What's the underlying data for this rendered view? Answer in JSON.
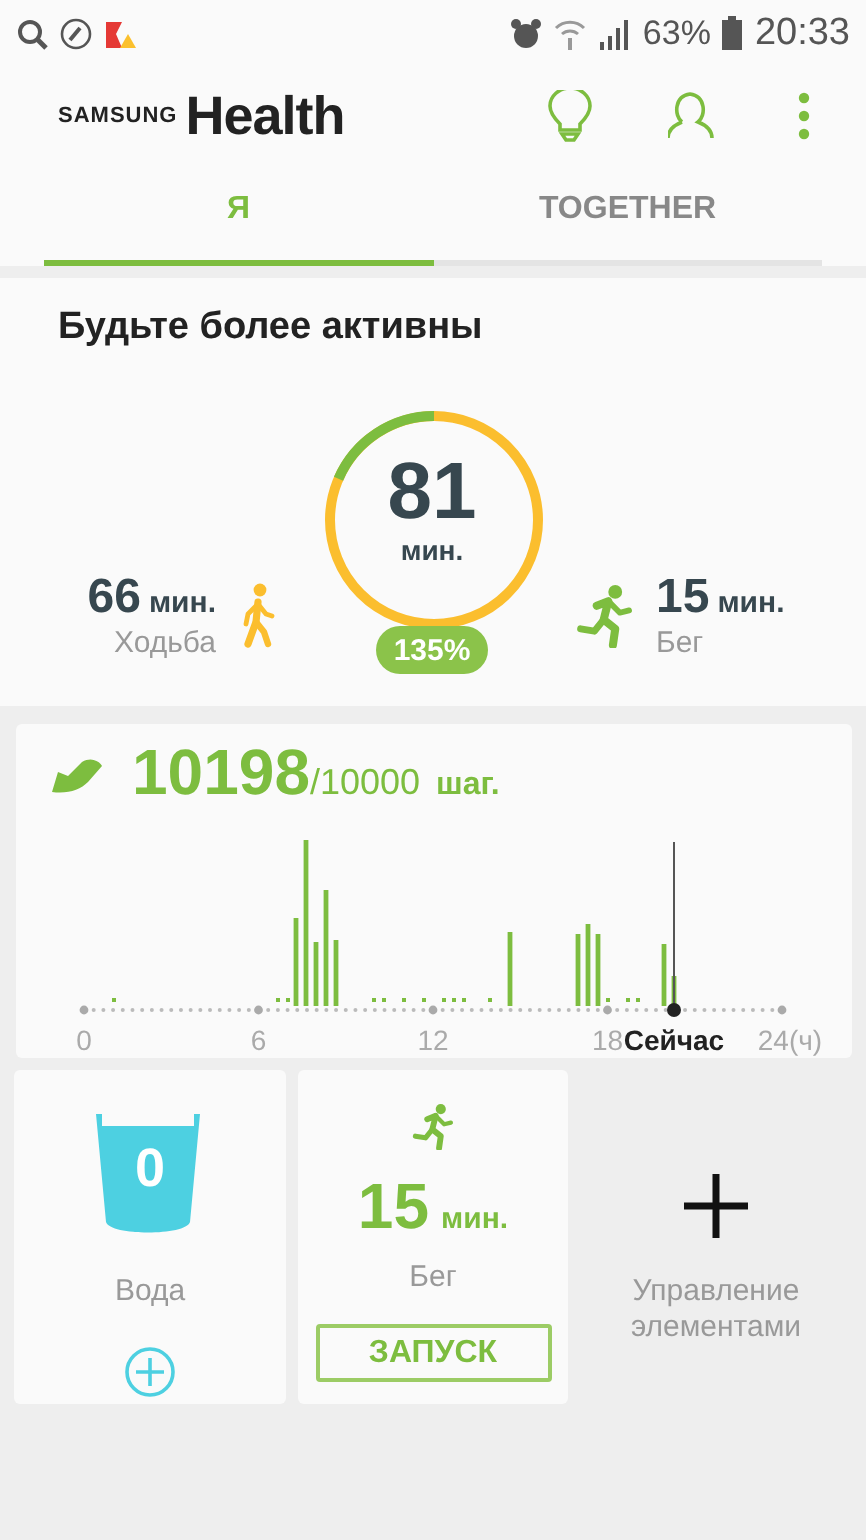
{
  "status_bar": {
    "battery": "63%",
    "time": "20:33"
  },
  "header": {
    "brand": "SAMSUNG",
    "product": "Health"
  },
  "tabs": [
    {
      "label": "Я",
      "selected": true
    },
    {
      "label": "TOGETHER",
      "selected": false
    }
  ],
  "activity": {
    "title": "Будьте более активны",
    "total": "81",
    "total_unit": "мин.",
    "percent": "135%",
    "items": [
      {
        "kind": "walk",
        "value": "66",
        "unit": "мин.",
        "label": "Ходьба"
      },
      {
        "kind": "run",
        "value": "15",
        "unit": "мин.",
        "label": "Бег"
      }
    ]
  },
  "steps": {
    "count": "10198",
    "goal": "/10000",
    "unit": "шаг.",
    "x_labels": [
      "0",
      "6",
      "12",
      "18",
      "24(ч)"
    ],
    "now_label": "Сейчас"
  },
  "tiles": [
    {
      "kind": "water",
      "value": "0",
      "label": "Вода"
    },
    {
      "kind": "exercise",
      "value": "15",
      "unit": "мин.",
      "label": "Бег",
      "button": "ЗАПУСК"
    },
    {
      "kind": "manage",
      "label": "Управление элементами"
    }
  ]
}
